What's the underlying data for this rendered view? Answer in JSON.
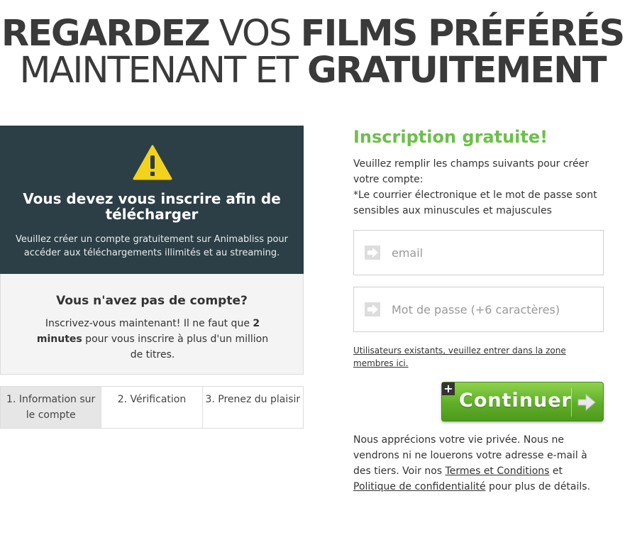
{
  "headline": {
    "line1_bold1": "REGARDEZ",
    "line1_normal": " VOS ",
    "line1_bold2": "FILMS PRÉFÉRÉS",
    "line2_normal": "MAINTENANT ET ",
    "line2_bold": "GRATUITEMENT"
  },
  "alert": {
    "icon": "warning-icon",
    "title": "Vous devez vous inscrire afin de télécharger",
    "text": "Veuillez créer un compte gratuitement sur Animabliss pour accéder aux téléchargements illimités et au streaming."
  },
  "no_account": {
    "title": "Vous n'avez pas de compte?",
    "text_before": "Inscrivez-vous maintenant! Il ne faut que ",
    "text_bold": "2 minutes",
    "text_after": " pour vous inscrire à plus d'un million de titres."
  },
  "steps": [
    {
      "label": "1. Information sur le compte",
      "active": true
    },
    {
      "label": "2. Vérification",
      "active": false
    },
    {
      "label": "3. Prenez du plaisir",
      "active": false
    }
  ],
  "form": {
    "title": "Inscription gratuite!",
    "intro_line1": "Veuillez remplir les champs suivants pour créer votre compte:",
    "intro_line2": "*Le courrier électronique et le mot de passe sont sensibles aux minuscules et majuscules",
    "email_placeholder": "email",
    "password_placeholder": "Mot de passe (+6 caractères)",
    "existing_link": "Utilisateurs existants, veuillez entrer dans la zone membres ici.",
    "continue_label": "Continuer",
    "accent_color": "#6cc04a"
  },
  "privacy": {
    "text_before": "Nous apprécions votre vie privée. Nous ne vendrons ni ne louerons votre adresse e-mail à des tiers. Voir nos ",
    "terms_link": "Termes et Conditions",
    "text_middle": " et ",
    "policy_link": "Politique de confidentialité",
    "text_after": " pour plus de détails."
  }
}
